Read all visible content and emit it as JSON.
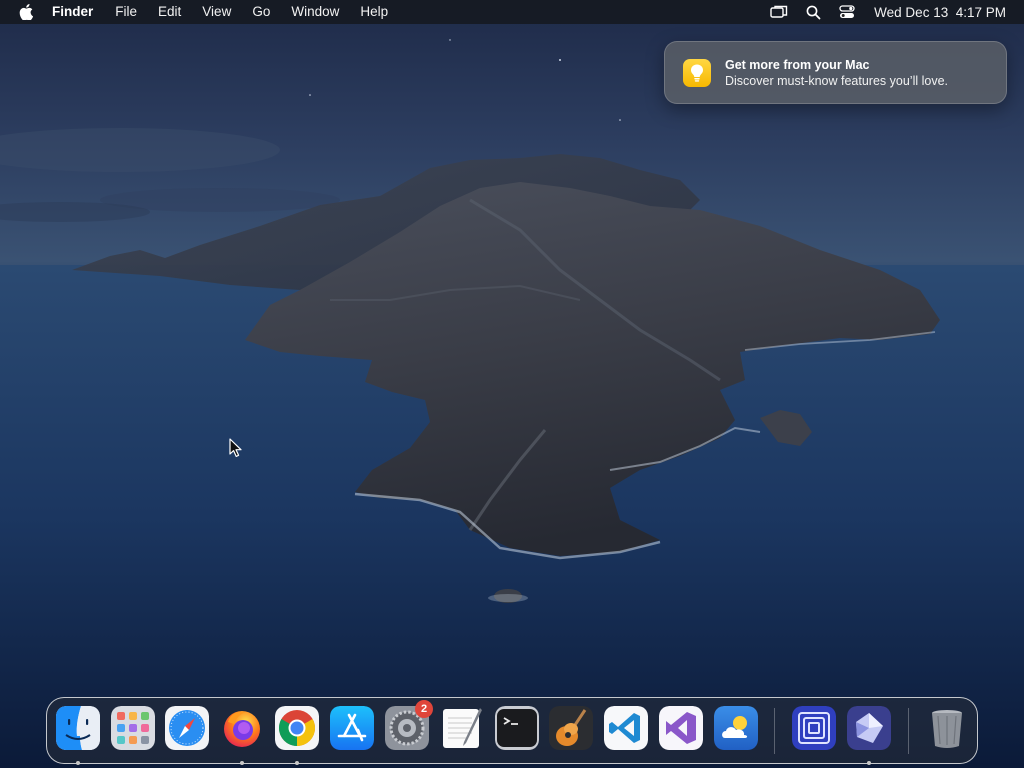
{
  "menubar": {
    "app_name": "Finder",
    "menus": [
      "File",
      "Edit",
      "View",
      "Go",
      "Window",
      "Help"
    ],
    "clock": "Wed Dec 13  4:17 PM"
  },
  "notification": {
    "title": "Get more from your Mac",
    "body": "Discover must-know features you’ll love.",
    "icon": "lightbulb-icon"
  },
  "dock": {
    "apps": [
      {
        "name": "Finder",
        "icon": "finder-icon",
        "running": true
      },
      {
        "name": "Launchpad",
        "icon": "launchpad-icon",
        "running": false
      },
      {
        "name": "Safari",
        "icon": "safari-icon",
        "running": false
      },
      {
        "name": "Firefox",
        "icon": "firefox-icon",
        "running": true
      },
      {
        "name": "Google Chrome",
        "icon": "chrome-icon",
        "running": true
      },
      {
        "name": "App Store",
        "icon": "app-store-icon",
        "running": false
      },
      {
        "name": "System Preferences",
        "icon": "system-preferences-icon",
        "running": false,
        "badge": "2"
      },
      {
        "name": "TextEdit",
        "icon": "textedit-icon",
        "running": false
      },
      {
        "name": "Terminal",
        "icon": "terminal-icon",
        "running": false
      },
      {
        "name": "GarageBand",
        "icon": "garageband-icon",
        "running": false
      },
      {
        "name": "Visual Studio Code",
        "icon": "vscode-icon",
        "running": false
      },
      {
        "name": "Visual Studio",
        "icon": "visual-studio-icon",
        "running": false
      },
      {
        "name": "Weather",
        "icon": "weather-icon",
        "running": false
      },
      {
        "name": "Screen Sharing",
        "icon": "screen-sharing-icon",
        "running": false
      },
      {
        "name": "Linear",
        "icon": "linear-icon",
        "running": true
      },
      {
        "name": "Trash",
        "icon": "trash-icon",
        "running": false
      }
    ]
  }
}
